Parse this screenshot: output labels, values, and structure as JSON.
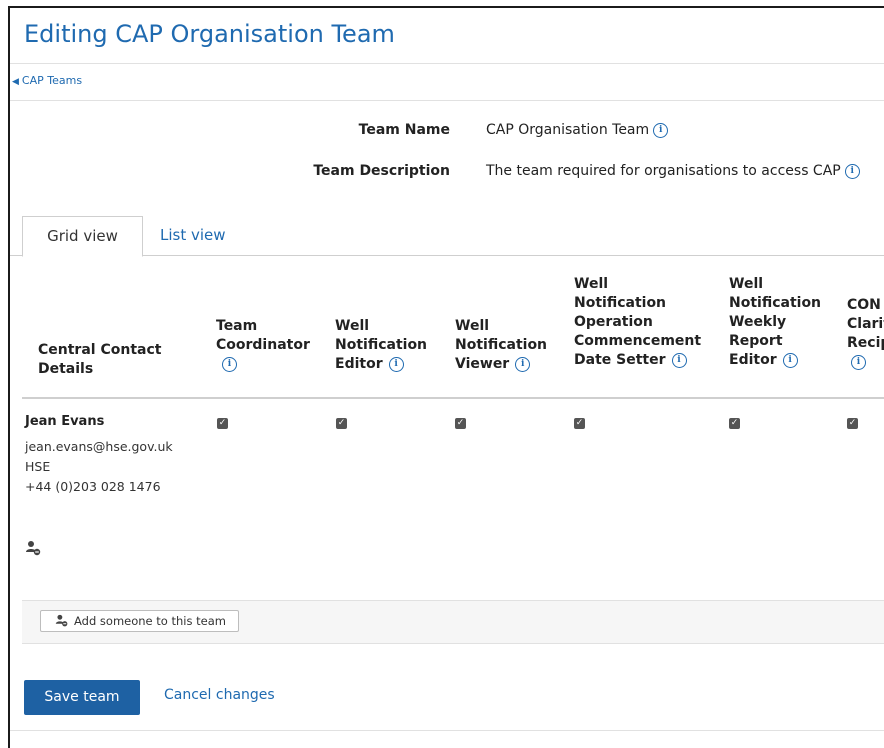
{
  "page": {
    "title": "Editing CAP Organisation Team",
    "back_link": "CAP Teams"
  },
  "team": {
    "name_label": "Team Name",
    "name_value": "CAP Organisation Team",
    "description_label": "Team Description",
    "description_value": "The team required for organisations to access CAP"
  },
  "tabs": [
    {
      "label": "Grid view",
      "active": true
    },
    {
      "label": "List view",
      "active": false
    }
  ],
  "columns": [
    {
      "lines": [
        "",
        "",
        "",
        "Central Contact",
        "Details"
      ],
      "info": false
    },
    {
      "lines": [
        "",
        "",
        "Team",
        "Coordinator"
      ],
      "info": true
    },
    {
      "lines": [
        "",
        "",
        "Well",
        "Notification",
        "Editor"
      ],
      "info": true,
      "info_inline": true
    },
    {
      "lines": [
        "",
        "",
        "Well",
        "Notification",
        "Viewer"
      ],
      "info": true,
      "info_inline": true
    },
    {
      "lines": [
        "Well",
        "Notification",
        "Operation",
        "Commencement",
        "Date Setter"
      ],
      "info": true,
      "info_inline": true
    },
    {
      "lines": [
        "Well",
        "Notification",
        "Weekly",
        "Report",
        "Editor"
      ],
      "info": true,
      "info_inline": true
    },
    {
      "lines": [
        "CON",
        "Clarif",
        "Recip"
      ],
      "info": true
    }
  ],
  "member": {
    "name": "Jean Evans",
    "email": "jean.evans@hse.gov.uk",
    "organisation": "HSE",
    "phone": "+44 (0)203 028 1476",
    "roles_checked": [
      true,
      true,
      true,
      true,
      true,
      true
    ]
  },
  "actions": {
    "add_member": "Add someone to this team",
    "save": "Save team",
    "cancel": "Cancel changes"
  },
  "colors": {
    "link": "#1f6ab0",
    "primary_button": "#1e61a3"
  },
  "icons": {
    "info": "info-circle-icon",
    "person": "person-add-icon",
    "back": "triangle-left-icon",
    "check": "checkbox-checked-icon"
  }
}
